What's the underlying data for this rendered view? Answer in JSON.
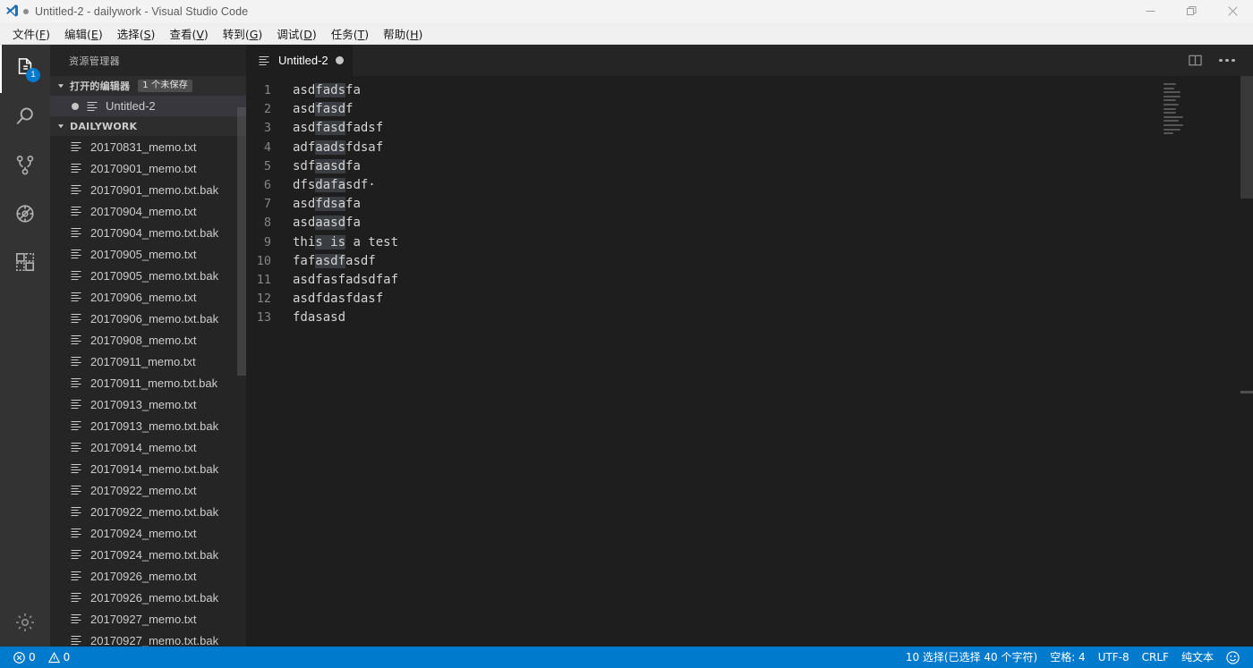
{
  "window": {
    "title": "Untitled-2 - dailywork - Visual Studio Code",
    "dirty_indicator": "●",
    "logo_icon": "vscode-logo-icon",
    "controls": {
      "minimize": "minimize-icon",
      "restore": "restore-icon",
      "close": "close-icon"
    }
  },
  "menubar": {
    "items": [
      {
        "label": "文件",
        "mnemonic": "F"
      },
      {
        "label": "编辑",
        "mnemonic": "E"
      },
      {
        "label": "选择",
        "mnemonic": "S"
      },
      {
        "label": "查看",
        "mnemonic": "V"
      },
      {
        "label": "转到",
        "mnemonic": "G"
      },
      {
        "label": "调试",
        "mnemonic": "D"
      },
      {
        "label": "任务",
        "mnemonic": "T"
      },
      {
        "label": "帮助",
        "mnemonic": "H"
      }
    ]
  },
  "activitybar": {
    "items": [
      {
        "name": "explorer",
        "icon": "files-icon",
        "active": true,
        "badge": "1"
      },
      {
        "name": "search",
        "icon": "search-icon",
        "active": false,
        "badge": ""
      },
      {
        "name": "source-control",
        "icon": "source-control-icon",
        "active": false,
        "badge": ""
      },
      {
        "name": "debug",
        "icon": "debug-icon",
        "active": false,
        "badge": ""
      },
      {
        "name": "extensions",
        "icon": "extensions-icon",
        "active": false,
        "badge": ""
      }
    ],
    "settings": {
      "name": "settings",
      "icon": "gear-icon"
    }
  },
  "sidebar": {
    "title": "资源管理器",
    "open_editors": {
      "label": "打开的编辑器",
      "badge": "1 个未保存",
      "items": [
        {
          "label": "Untitled-2",
          "dirty": true,
          "icon": "text-file-icon"
        }
      ]
    },
    "folder": {
      "label": "DAILYWORK",
      "files": [
        "20170831_memo.txt",
        "20170901_memo.txt",
        "20170901_memo.txt.bak",
        "20170904_memo.txt",
        "20170904_memo.txt.bak",
        "20170905_memo.txt",
        "20170905_memo.txt.bak",
        "20170906_memo.txt",
        "20170906_memo.txt.bak",
        "20170908_memo.txt",
        "20170911_memo.txt",
        "20170911_memo.txt.bak",
        "20170913_memo.txt",
        "20170913_memo.txt.bak",
        "20170914_memo.txt",
        "20170914_memo.txt.bak",
        "20170922_memo.txt",
        "20170922_memo.txt.bak",
        "20170924_memo.txt",
        "20170924_memo.txt.bak",
        "20170926_memo.txt",
        "20170926_memo.txt.bak",
        "20170927_memo.txt",
        "20170927_memo.txt.bak"
      ]
    }
  },
  "editor": {
    "tab": {
      "label": "Untitled-2",
      "dirty": true,
      "icon": "text-file-icon"
    },
    "actions": {
      "split": "split-editor-icon",
      "more": "more-actions-icon"
    },
    "lines": [
      {
        "num": "1",
        "pre": "asd",
        "sel": "fads",
        "post": "fa"
      },
      {
        "num": "2",
        "pre": "asd",
        "sel": "fasd",
        "post": "f"
      },
      {
        "num": "3",
        "pre": "asd",
        "sel": "fasd",
        "post": "fadsf"
      },
      {
        "num": "4",
        "pre": "adf",
        "sel": "aads",
        "post": "fdsaf"
      },
      {
        "num": "5",
        "pre": "sdf",
        "sel": "aasd",
        "post": "fa"
      },
      {
        "num": "6",
        "pre": "dfs",
        "sel": "dafa",
        "post": "sdf·"
      },
      {
        "num": "7",
        "pre": "asd",
        "sel": "fdsa",
        "post": "fa"
      },
      {
        "num": "8",
        "pre": "asd",
        "sel": "aasd",
        "post": "fa"
      },
      {
        "num": "9",
        "pre": "thi",
        "sel": "s is",
        "post": " a test"
      },
      {
        "num": "10",
        "pre": "faf",
        "sel": "asdf",
        "post": "asdf"
      },
      {
        "num": "11",
        "pre": "asdfasfadsdfaf",
        "sel": "",
        "post": ""
      },
      {
        "num": "12",
        "pre": "asdfdasfdasf",
        "sel": "",
        "post": ""
      },
      {
        "num": "13",
        "pre": "fdasasd",
        "sel": "",
        "post": ""
      }
    ]
  },
  "statusbar": {
    "left": [
      {
        "name": "errors",
        "icon": "error-icon",
        "text": "0"
      },
      {
        "name": "warnings",
        "icon": "warning-icon",
        "text": "0"
      }
    ],
    "right": [
      {
        "name": "selection-info",
        "text": "10 选择(已选择 40 个字符)"
      },
      {
        "name": "indentation",
        "text": "空格: 4"
      },
      {
        "name": "encoding",
        "text": "UTF-8"
      },
      {
        "name": "eol",
        "text": "CRLF"
      },
      {
        "name": "language-mode",
        "text": "纯文本"
      },
      {
        "name": "feedback",
        "text": "",
        "icon": "smiley-icon"
      }
    ]
  },
  "colors": {
    "accent": "#007acc",
    "editor_bg": "#1e1e1e",
    "sidebar_bg": "#252526",
    "activitybar_bg": "#333333",
    "titlebar_bg": "#f3f3f3",
    "selection": "#3a3d41",
    "text": "#d4d4d4",
    "line_number": "#858585"
  }
}
